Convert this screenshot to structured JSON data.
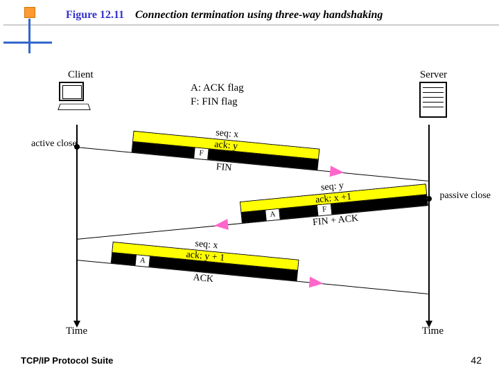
{
  "header": {
    "figure_num": "Figure 12.11",
    "figure_title": "Connection termination using three-way handshaking"
  },
  "diagram": {
    "client_label": "Client",
    "server_label": "Server",
    "time_label": "Time",
    "active_close": "active close",
    "passive_close": "passive close",
    "legend_a": "A: ACK flag",
    "legend_f": "F: FIN flag",
    "segments": {
      "seg1": {
        "seq": "seq: x",
        "ack": "ack: y",
        "flag_f": "F",
        "name": "FIN"
      },
      "seg2": {
        "seq": "seq: y",
        "ack": "ack: x +1",
        "flag_a": "A",
        "flag_f": "F",
        "name": "FIN + ACK"
      },
      "seg3": {
        "seq": "seq: x",
        "ack": "ack: y + 1",
        "flag_a": "A",
        "name": "ACK"
      }
    }
  },
  "footer": {
    "suite": "TCP/IP Protocol Suite",
    "page": "42"
  }
}
